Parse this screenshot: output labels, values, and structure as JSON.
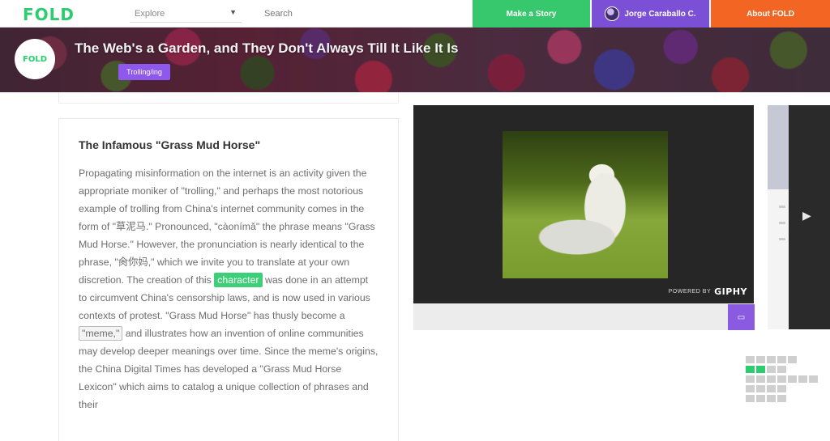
{
  "nav": {
    "logo": "FOLD",
    "explore_label": "Explore",
    "search_placeholder": "Search",
    "make_story": "Make a Story",
    "user_name": "Jorge Caraballo C.",
    "about": "About FOLD"
  },
  "banner": {
    "logo": "FOLD",
    "title": "The Web's a Garden, and They Don't Always Till It Like It Is",
    "tag": "Trolling/ing"
  },
  "article": {
    "heading": "The Infamous \"Grass Mud Horse\"",
    "p1": "Propagating misinformation on the internet is an activity given the appropriate moniker of \"trolling,\" and perhaps the most notorious example of trolling from China's internet community comes in the form of \"草泥马.\" Pronounced, \"càonímǎ\" the phrase means \"Grass Mud Horse.\" However, the pronunciation is nearly identical to the phrase, \"肏你妈,\" which we invite you to translate at your own discretion. The creation of this",
    "highlight": "character",
    "p2": "was done in an attempt to circumvent China's censorship laws, and is now used in various contexts of protest. \"Grass Mud Horse\" has thusly become a",
    "meme": "\"meme,\"",
    "p3": "and illustrates how an invention of online communities may develop deeper meanings over time. Since the meme's origins, the China Digital Times has developed a \"Grass Mud Horse Lexicon\" which aims to catalog a unique collection of phrases and their"
  },
  "media": {
    "credit_prefix": "POWERED BY",
    "credit_brand": "GIPHY",
    "corner_icon": "expand-icon"
  },
  "colors": {
    "brand_green": "#2ecc71",
    "purple": "#7b4fd6",
    "orange": "#f26522"
  },
  "grid": [
    [
      false,
      false,
      false,
      false,
      false
    ],
    [
      true,
      true,
      false,
      false
    ],
    [
      false,
      false,
      false,
      false,
      false,
      false,
      false
    ],
    [
      false,
      false,
      false,
      false
    ],
    [
      false,
      false,
      false,
      false
    ]
  ]
}
